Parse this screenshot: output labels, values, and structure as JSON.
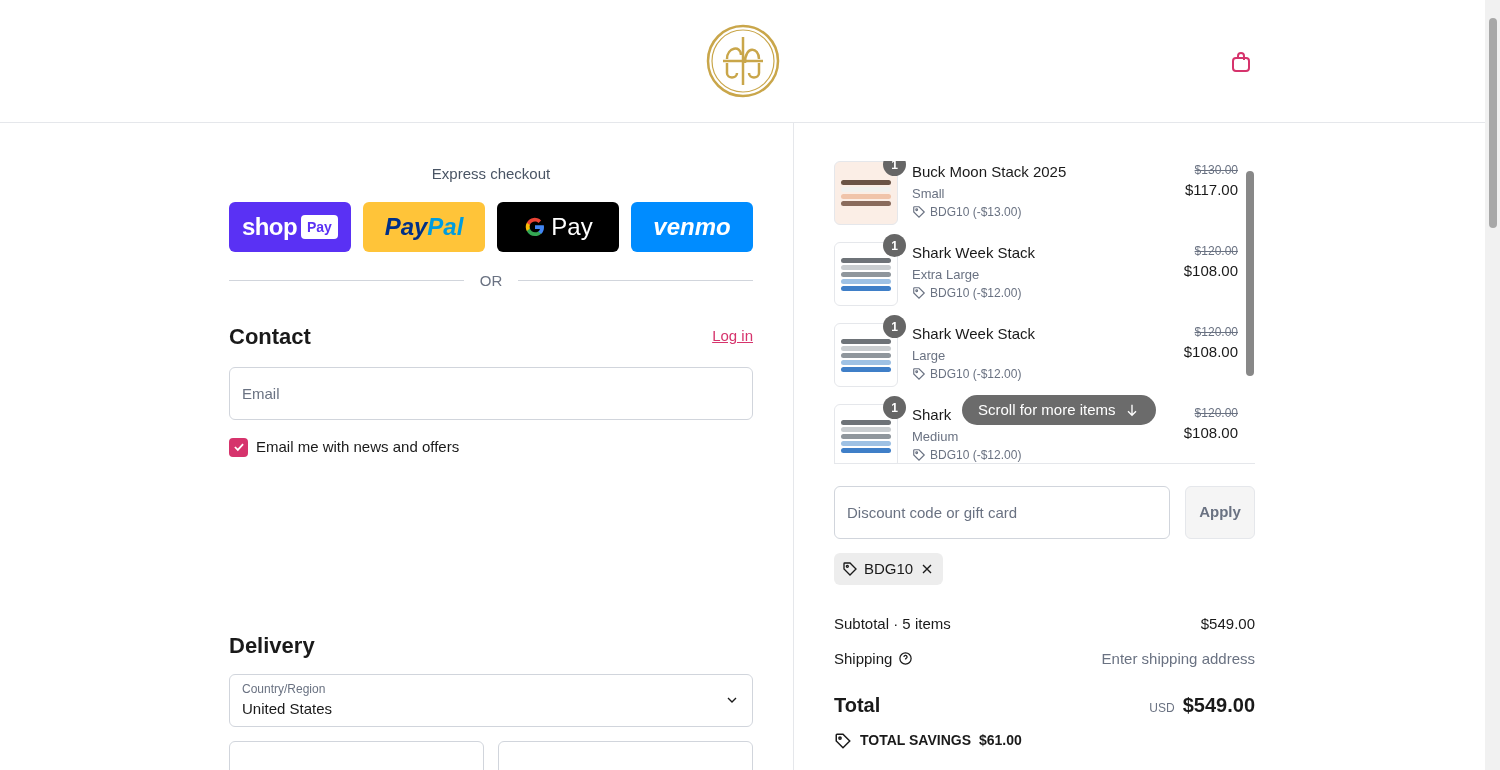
{
  "express": {
    "title": "Express checkout",
    "buttons": [
      {
        "kind": "shop",
        "text": "shop",
        "badge": "Pay"
      },
      {
        "kind": "paypal",
        "text": "Pay",
        "text2": "Pal"
      },
      {
        "kind": "gpay",
        "text": "Pay"
      },
      {
        "kind": "venmo",
        "text": "venmo"
      }
    ],
    "divider": "OR"
  },
  "contact": {
    "title": "Contact",
    "login": "Log in",
    "email": {
      "placeholder": "Email"
    },
    "newsletter": {
      "label": "Email me with news and offers",
      "checked": true
    }
  },
  "delivery": {
    "title": "Delivery",
    "country": {
      "label": "Country/Region",
      "value": "United States"
    }
  },
  "items": [
    {
      "qty": "1",
      "title": "Buck Moon Stack 2025",
      "variant": "Small",
      "discount": "BDG10 (-$13.00)",
      "old_price": "$130.00",
      "price": "$117.00",
      "kind": "peach"
    },
    {
      "qty": "1",
      "title": "Shark Week Stack",
      "variant": "Extra Large",
      "discount": "BDG10 (-$12.00)",
      "old_price": "$120.00",
      "price": "$108.00",
      "kind": "blue"
    },
    {
      "qty": "1",
      "title": "Shark Week Stack",
      "variant": "Large",
      "discount": "BDG10 (-$12.00)",
      "old_price": "$120.00",
      "price": "$108.00",
      "kind": "blue"
    },
    {
      "qty": "1",
      "title": "Shark",
      "variant": "Medium",
      "discount": "BDG10 (-$12.00)",
      "old_price": "$120.00",
      "price": "$108.00",
      "kind": "blue"
    }
  ],
  "scroll_hint": "Scroll for more items",
  "discount": {
    "placeholder": "Discount code or gift card",
    "apply": "Apply",
    "applied_code": "BDG10"
  },
  "summary": {
    "subtotal_label": "Subtotal · 5 items",
    "subtotal": "$549.00",
    "shipping_label": "Shipping",
    "shipping_value": "Enter shipping address",
    "total_label": "Total",
    "currency": "USD",
    "total": "$549.00",
    "savings_label": "TOTAL SAVINGS",
    "savings": "$61.00"
  }
}
